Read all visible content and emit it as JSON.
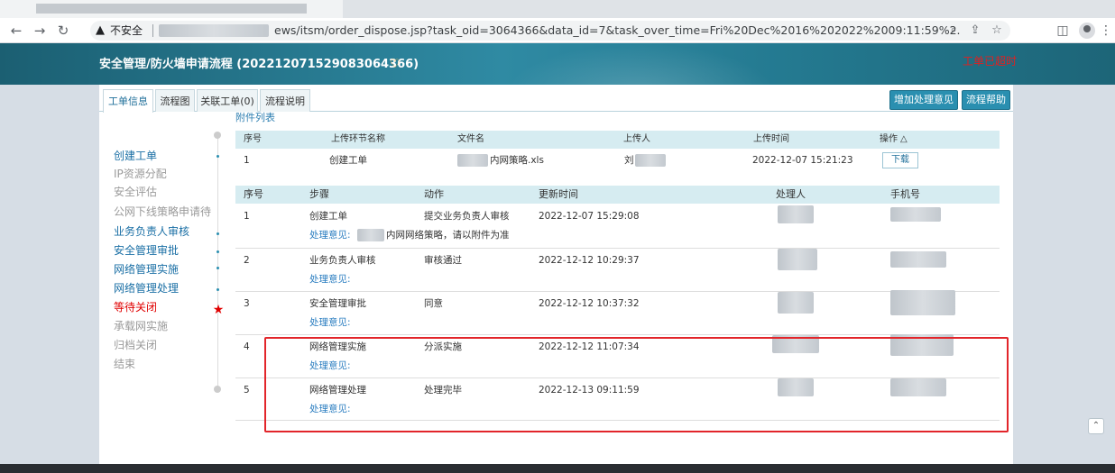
{
  "browser": {
    "security_label": "不安全",
    "url": "ews/itsm/order_dispose.jsp?task_oid=3064366&data_id=7&task_over_time=Fri%20Dec%2016%202022%2009:11:59%2..."
  },
  "header": {
    "title": "安全管理/防火墙申请流程 (20221207152908306436​6)",
    "status": "工单已超时"
  },
  "tabs": [
    "工单信息",
    "流程图",
    "关联工单(0)",
    "流程说明"
  ],
  "actions": {
    "add_opinion": "增加处理意见",
    "help": "流程帮助"
  },
  "attachments": {
    "title": "附件列表",
    "columns": [
      "序号",
      "上传环节名称",
      "文件名",
      "上传人",
      "上传时间",
      "操作"
    ],
    "sort_glyph": "△",
    "rows": [
      {
        "index": "1",
        "stage": "创建工单",
        "filename": "内网策略.xls",
        "uploader": "刘",
        "time": "2022-12-07 15:21:23",
        "action": "下载"
      }
    ]
  },
  "steps": [
    {
      "label": "创建工单",
      "state": "done"
    },
    {
      "label": "IP资源分配",
      "state": "pending"
    },
    {
      "label": "安全评估",
      "state": "pending"
    },
    {
      "label": "公网下线策略申请待",
      "state": "pending"
    },
    {
      "label": "业务负责人审核",
      "state": "done"
    },
    {
      "label": "安全管理审批",
      "state": "done"
    },
    {
      "label": "网络管理实施",
      "state": "done"
    },
    {
      "label": "网络管理处理",
      "state": "done"
    },
    {
      "label": "等待关闭",
      "state": "current"
    },
    {
      "label": "承载网实施",
      "state": "pending"
    },
    {
      "label": "归档关闭",
      "state": "pending"
    },
    {
      "label": "结束",
      "state": "pending"
    }
  ],
  "process": {
    "columns": [
      "序号",
      "步骤",
      "动作",
      "更新时间",
      "处理人",
      "手机号"
    ],
    "opinion_label": "处理意见:",
    "rows": [
      {
        "index": "1",
        "step": "创建工单",
        "action": "提交业务负责人审核",
        "time": "2022-12-07 15:29:08",
        "opinion": "内网网络策略，请以附件为准"
      },
      {
        "index": "2",
        "step": "业务负责人审核",
        "action": "审核通过",
        "time": "2022-12-12 10:29:37",
        "opinion": ""
      },
      {
        "index": "3",
        "step": "安全管理审批",
        "action": "同意",
        "time": "2022-12-12 10:37:32",
        "opinion": ""
      },
      {
        "index": "4",
        "step": "网络管理实施",
        "action": "分派实施",
        "time": "2022-12-12 11:07:34",
        "opinion": ""
      },
      {
        "index": "5",
        "step": "网络管理处理",
        "action": "处理完毕",
        "time": "2022-12-13 09:11:59",
        "opinion": ""
      }
    ]
  },
  "colors": {
    "header_bg": "#2a8aa3",
    "link_blue": "#1a6fa5",
    "alert_red": "#e00000",
    "table_header": "#d6ecf1"
  }
}
